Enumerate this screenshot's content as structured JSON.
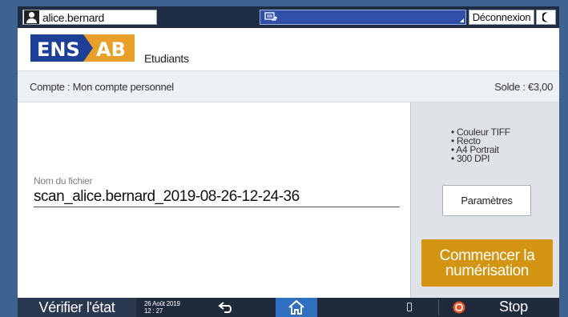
{
  "topbar": {
    "user_name": "alice.bernard",
    "logout_label": "Déconnexion"
  },
  "header": {
    "logo_text_left": "ENS",
    "logo_text_right": "AB",
    "department": "Etudiants"
  },
  "account": {
    "account_label": "Compte : Mon compte personnel",
    "balance_label": "Solde : €3,00"
  },
  "file": {
    "label": "Nom du fichier",
    "value": "scan_alice.bernard_2019-08-26-12-24-36"
  },
  "scan_settings": {
    "items": [
      "Couleur TIFF",
      "Recto",
      "A4 Portrait",
      "300 DPI"
    ],
    "params_button": "Paramètres",
    "start_line1": "Commencer la",
    "start_line2": "numérisation"
  },
  "bottombar": {
    "check_status": "Vérifier l'état",
    "date": "26 Août 2019",
    "time": "12 : 27",
    "stop_label": "Stop"
  },
  "colors": {
    "background": "#3f6390",
    "topbar": "#1f2d44",
    "status_box": "#2f4fa8",
    "logo_blue": "#1d3f95",
    "logo_orange": "#e8a02a",
    "start_button": "#d39412",
    "home_button": "#2e6fc0",
    "stop_icon": "#e2572b"
  },
  "icons": {
    "user": "user-icon",
    "status": "device-status-icon",
    "moon": "moon-icon",
    "back": "back-arrow-icon",
    "home": "home-icon",
    "memory": "memory-icon",
    "stop": "stop-icon"
  }
}
